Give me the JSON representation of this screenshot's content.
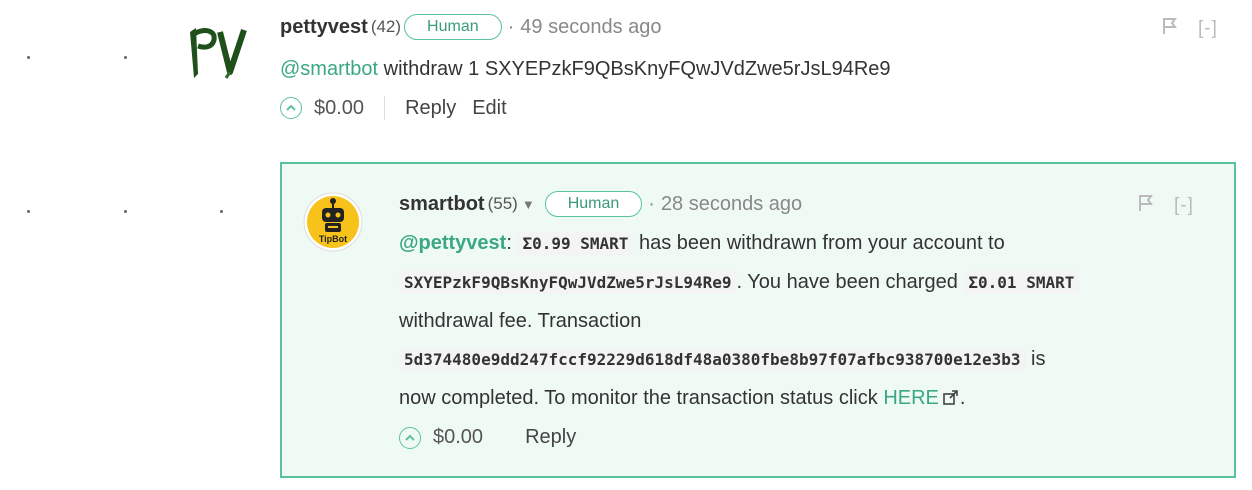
{
  "comment1": {
    "author": "pettyvest",
    "reputation": "(42)",
    "badge": "Human",
    "separator": "·",
    "time": "49 seconds ago",
    "avatar_text": "PV",
    "mention": "@smartbot",
    "text": " withdraw 1 SXYEPzkF9QBsKnyFQwJVdZwe5rJsL94Re9",
    "payout": "$0.00",
    "reply_label": "Reply",
    "edit_label": "Edit",
    "collapse_label": "[-]"
  },
  "comment2": {
    "author": "smartbot",
    "reputation": "(55)",
    "badge": "Human",
    "separator": "·",
    "time": "28 seconds ago",
    "avatar_label": "TipBot",
    "mention": "@pettyvest",
    "colon": ":",
    "amount": "Σ0.99 SMART",
    "text_1": " has been withdrawn from your account to",
    "address": "SXYEPzkF9QBsKnyFQwJVdZwe5rJsL94Re9",
    "text_2": ". You have been charged ",
    "fee": "Σ0.01 SMART",
    "text_3": "withdrawal fee. Transaction",
    "txid": "5d374480e9dd247fccf92229d618df48a0380fbe8b97f07afbc938700e12e3b3",
    "text_4": " is",
    "text_5": "now completed. To monitor the transaction status click ",
    "link_label": "HERE",
    "text_6": ".",
    "payout": "$0.00",
    "reply_label": "Reply",
    "collapse_label": "[-]"
  },
  "colors": {
    "accent": "#5ac39b",
    "reply_bg": "#f0faf4"
  },
  "icons": [
    "flag-icon",
    "upvote-icon",
    "external-link-icon",
    "dropdown-caret-icon"
  ]
}
